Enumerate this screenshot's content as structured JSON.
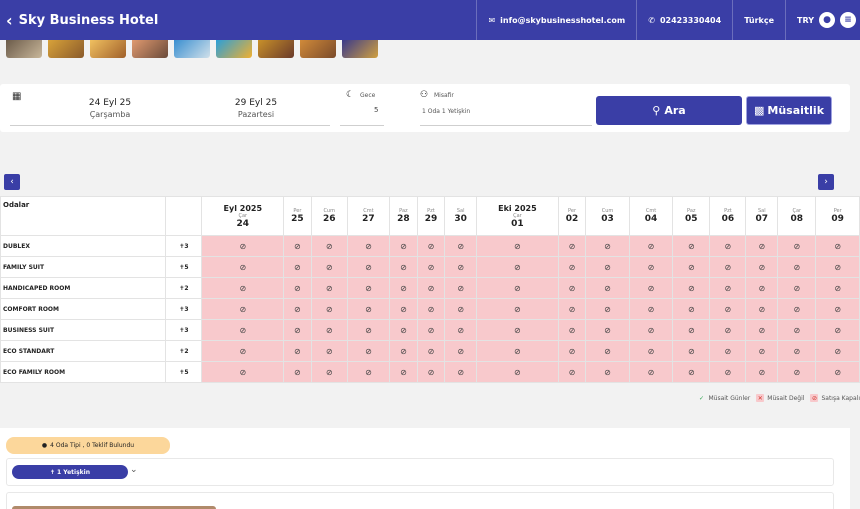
{
  "header": {
    "hotel_name": "Sky Business Hotel",
    "email": "info@skybusinesshotel.com",
    "phone": "02423330404",
    "language": "Türkçe",
    "currency": "TRY"
  },
  "search": {
    "checkin_date": "24 Eyl 25",
    "checkin_day": "Çarşamba",
    "checkout_date": "29 Eyl 25",
    "checkout_day": "Pazartesi",
    "nights_label": "Gece",
    "nights_value": "5",
    "guest_label": "Misafir",
    "guest_value": "1 Oda  1 Yetişkin",
    "search_button": "Ara",
    "availability_button": "Müsaitlik"
  },
  "calendar": {
    "rooms_header": "Odalar",
    "columns": [
      {
        "month": "Eyl 2025",
        "weekday": "Çar",
        "day": "24"
      },
      {
        "weekday": "Per",
        "day": "25"
      },
      {
        "weekday": "Cum",
        "day": "26"
      },
      {
        "weekday": "Cmt",
        "day": "27"
      },
      {
        "weekday": "Paz",
        "day": "28"
      },
      {
        "weekday": "Pzt",
        "day": "29"
      },
      {
        "weekday": "Sal",
        "day": "30"
      },
      {
        "month": "Eki 2025",
        "weekday": "Çar",
        "day": "01"
      },
      {
        "weekday": "Per",
        "day": "02"
      },
      {
        "weekday": "Cum",
        "day": "03"
      },
      {
        "weekday": "Cmt",
        "day": "04"
      },
      {
        "weekday": "Paz",
        "day": "05"
      },
      {
        "weekday": "Pzt",
        "day": "06"
      },
      {
        "weekday": "Sal",
        "day": "07"
      },
      {
        "weekday": "Çar",
        "day": "08"
      },
      {
        "weekday": "Per",
        "day": "09"
      }
    ],
    "rooms": [
      {
        "name": "DUBLEX",
        "capacity": "3"
      },
      {
        "name": "FAMILY SUIT",
        "capacity": "5"
      },
      {
        "name": "HANDICAPED ROOM",
        "capacity": "2"
      },
      {
        "name": "COMFORT ROOM",
        "capacity": "3"
      },
      {
        "name": "BUSINESS SUIT",
        "capacity": "3"
      },
      {
        "name": "ECO STANDART",
        "capacity": "2"
      },
      {
        "name": "ECO FAMILY ROOM",
        "capacity": "5"
      }
    ],
    "cell_status": "closed"
  },
  "legend": {
    "available": "Müsait Günler",
    "not_available": "Müsait Değil",
    "closed": "Satışa Kapalı"
  },
  "results": {
    "summary": "4 Oda Tipi , 0 Teklif Bulundu",
    "guest_filter": "1 Yetişkin"
  },
  "colors": {
    "brand": "#3a3ea6",
    "closed_cell": "#f8c9cc",
    "badge": "#fcd79b"
  }
}
